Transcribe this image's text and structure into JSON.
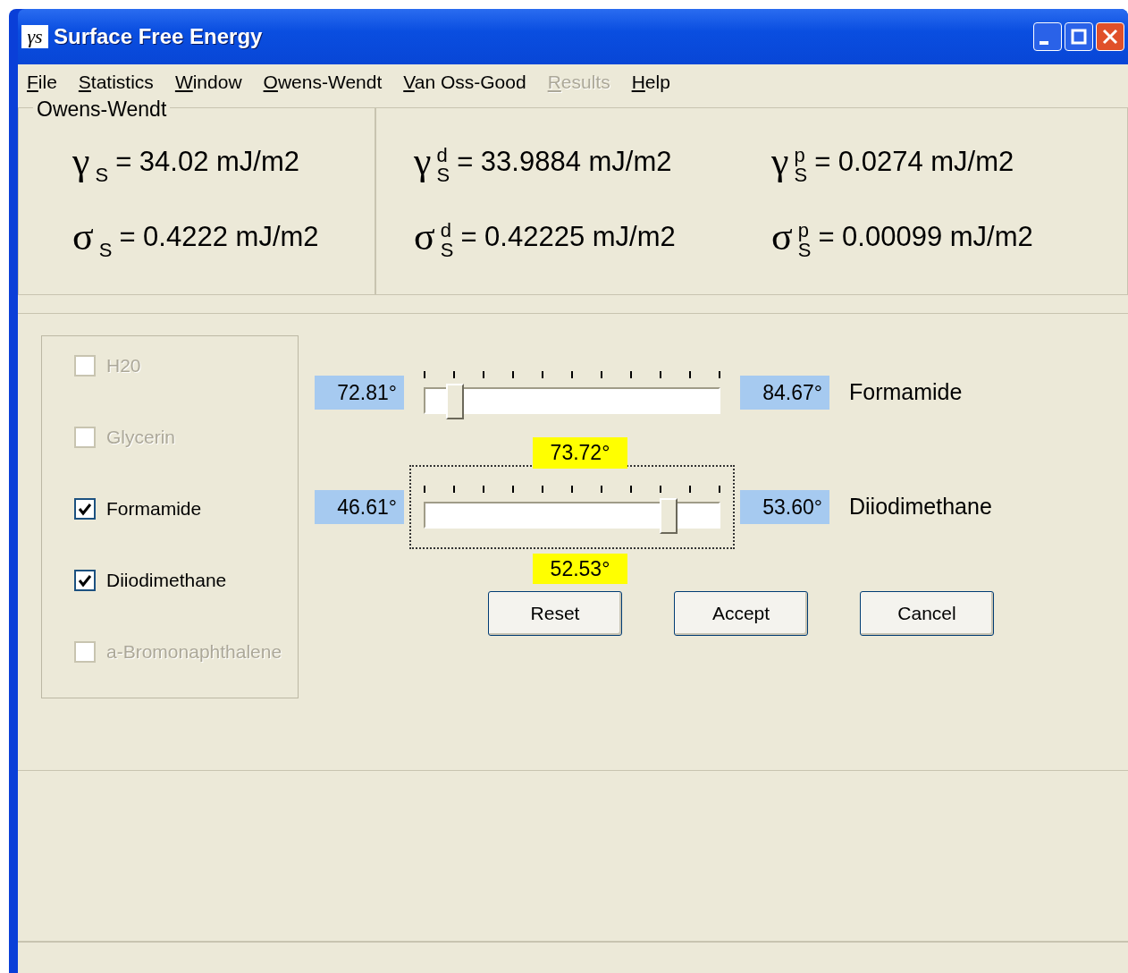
{
  "window": {
    "title": "Surface Free Energy",
    "icon_text": "γs"
  },
  "menu": [
    {
      "label": "File",
      "disabled": false
    },
    {
      "label": "Statistics",
      "disabled": false
    },
    {
      "label": "Window",
      "disabled": false
    },
    {
      "label": "Owens-Wendt",
      "disabled": false
    },
    {
      "label": "Van Oss-Good",
      "disabled": false
    },
    {
      "label": "Results",
      "disabled": true
    },
    {
      "label": "Help",
      "disabled": false
    }
  ],
  "results": {
    "title": "Owens-Wendt",
    "left": [
      {
        "symbol": "γ",
        "sub": "S",
        "value": "= 34.02 mJ/m2"
      },
      {
        "symbol": "σ",
        "sub": "S",
        "value": "= 0.4222 mJ/m2"
      }
    ],
    "right": [
      {
        "symbol": "γ",
        "sub": "S",
        "sup": "d",
        "value": "= 33.9884 mJ/m2"
      },
      {
        "symbol": "γ",
        "sub": "S",
        "sup": "p",
        "value": "= 0.0274 mJ/m2"
      },
      {
        "symbol": "σ",
        "sub": "S",
        "sup": "d",
        "value": "= 0.42225 mJ/m2"
      },
      {
        "symbol": "σ",
        "sub": "S",
        "sup": "p",
        "value": "= 0.00099 mJ/m2"
      }
    ]
  },
  "liquids": [
    {
      "label": "H20",
      "checked": false,
      "disabled": true
    },
    {
      "label": "Glycerin",
      "checked": false,
      "disabled": true
    },
    {
      "label": "Formamide",
      "checked": true,
      "disabled": false
    },
    {
      "label": "Diiodimethane",
      "checked": true,
      "disabled": false
    },
    {
      "label": "a-Bromonaphthalene",
      "checked": false,
      "disabled": true
    }
  ],
  "sliders": [
    {
      "min": "72.81°",
      "max": "84.67°",
      "name": "Formamide",
      "level": 0.1,
      "focused": false
    },
    {
      "min": "46.61°",
      "max": "53.60°",
      "name": "Diiodimethane",
      "level": 0.83,
      "focused": true,
      "value_above": "73.72°",
      "value_below": "52.53°"
    }
  ],
  "buttons": [
    "Reset",
    "Accept",
    "Cancel"
  ]
}
